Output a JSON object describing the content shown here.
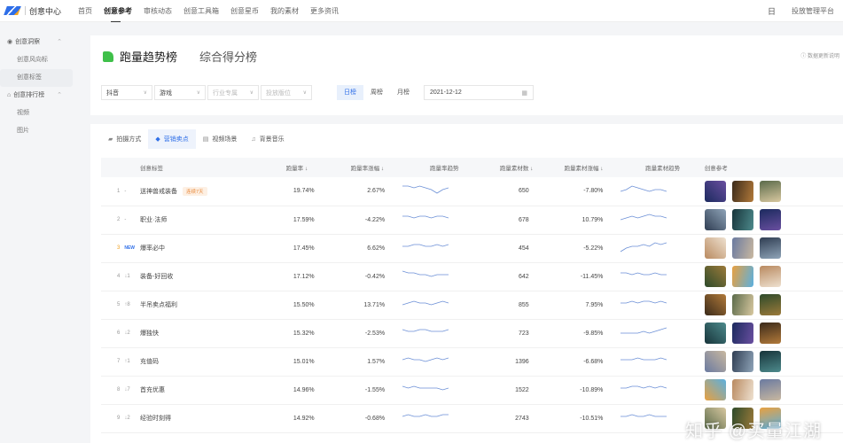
{
  "app": {
    "name": "创意中心"
  },
  "nav": [
    "首页",
    "创意参考",
    "审核动态",
    "创意工具箱",
    "创意星币",
    "我的素材",
    "更多资讯"
  ],
  "nav_active": 1,
  "topright": {
    "calendar_icon": "日",
    "platform": "投放管理平台"
  },
  "sidebar": [
    {
      "label": "创意洞察",
      "type": "group",
      "icon": "eye-icon"
    },
    {
      "label": "创意风向标",
      "type": "sub"
    },
    {
      "label": "创意标签",
      "type": "sub",
      "active": true
    },
    {
      "label": "创意排行榜",
      "type": "group",
      "icon": "chart-icon"
    },
    {
      "label": "视频",
      "type": "sub"
    },
    {
      "label": "图片",
      "type": "sub"
    }
  ],
  "header": {
    "title_active": "跑量趋势榜",
    "title_other": "综合得分榜",
    "note": "数据更新说明"
  },
  "filters": {
    "platform": "抖音",
    "category": "游戏",
    "industry_placeholder": "行业专属",
    "position_placeholder": "投放版位",
    "periods": [
      "日榜",
      "周榜",
      "月榜"
    ],
    "active_period": 0,
    "date": "2021-12-12"
  },
  "tabs": [
    {
      "label": "拍摄方式",
      "icon": "camera-icon"
    },
    {
      "label": "营销卖点",
      "icon": "tag-icon"
    },
    {
      "label": "视频场景",
      "icon": "scene-icon"
    },
    {
      "label": "背景音乐",
      "icon": "music-icon"
    }
  ],
  "active_tab": 1,
  "columns": [
    "创意标签",
    "跑量率 ↓",
    "跑量率涨幅 ↓",
    "跑量率趋势",
    "跑量素材数 ↓",
    "跑量素材涨幅 ↓",
    "跑量素材趋势",
    "创意参考"
  ],
  "rows": [
    {
      "rank": "1",
      "change": "-",
      "label": "送神兽戒装备",
      "badge": "连续7天",
      "rate": "19.74%",
      "rate_growth": "2.67%",
      "materials": "650",
      "mat_growth": "-7.80%",
      "t1": [
        5,
        5,
        4,
        5,
        4,
        3,
        1,
        3,
        4
      ],
      "t2": [
        2,
        3,
        5,
        4,
        3,
        2,
        3,
        3,
        2
      ]
    },
    {
      "rank": "2",
      "change": "-",
      "label": "职业·法师",
      "rate": "17.59%",
      "rate_growth": "-4.22%",
      "materials": "678",
      "mat_growth": "10.79%",
      "t1": [
        4,
        4,
        3,
        4,
        4,
        3,
        4,
        4,
        3
      ],
      "t2": [
        2,
        3,
        4,
        3,
        4,
        5,
        4,
        4,
        3
      ]
    },
    {
      "rank": "3",
      "change": "NEW",
      "label": "爆率必中",
      "rate": "17.45%",
      "rate_growth": "6.62%",
      "materials": "454",
      "mat_growth": "-5.22%",
      "t1": [
        3,
        3,
        4,
        4,
        3,
        3,
        4,
        3,
        4
      ],
      "t2": [
        0,
        2,
        3,
        3,
        4,
        3,
        5,
        4,
        5
      ]
    },
    {
      "rank": "4",
      "change": "↓1",
      "label": "装备-好回收",
      "rate": "17.12%",
      "rate_growth": "-0.42%",
      "materials": "642",
      "mat_growth": "-11.45%",
      "t1": [
        5,
        4,
        4,
        3,
        3,
        2,
        3,
        3,
        3
      ],
      "t2": [
        4,
        4,
        3,
        4,
        3,
        3,
        4,
        3,
        3
      ]
    },
    {
      "rank": "5",
      "change": "↑8",
      "label": "半吊卖点福利",
      "rate": "15.50%",
      "rate_growth": "13.71%",
      "materials": "855",
      "mat_growth": "7.95%",
      "t1": [
        2,
        3,
        4,
        3,
        3,
        2,
        3,
        4,
        3
      ],
      "t2": [
        3,
        3,
        4,
        3,
        4,
        4,
        3,
        4,
        3
      ]
    },
    {
      "rank": "6",
      "change": "↓2",
      "label": "爆独快",
      "rate": "15.32%",
      "rate_growth": "-2.53%",
      "materials": "723",
      "mat_growth": "-9.85%",
      "t1": [
        4,
        3,
        3,
        4,
        4,
        3,
        3,
        3,
        4
      ],
      "t2": [
        2,
        2,
        2,
        2,
        3,
        2,
        3,
        4,
        5
      ]
    },
    {
      "rank": "7",
      "change": "↑1",
      "label": "充值码",
      "rate": "15.01%",
      "rate_growth": "1.57%",
      "materials": "1396",
      "mat_growth": "-6.68%",
      "t1": [
        3,
        4,
        3,
        3,
        2,
        3,
        4,
        3,
        4
      ],
      "t2": [
        3,
        3,
        3,
        4,
        3,
        3,
        3,
        4,
        3
      ]
    },
    {
      "rank": "8",
      "change": "↓7",
      "label": "首充优惠",
      "rate": "14.96%",
      "rate_growth": "-1.55%",
      "materials": "1522",
      "mat_growth": "-10.89%",
      "t1": [
        4,
        3,
        4,
        3,
        3,
        3,
        3,
        2,
        3
      ],
      "t2": [
        3,
        3,
        4,
        4,
        3,
        4,
        3,
        4,
        3
      ]
    },
    {
      "rank": "9",
      "change": "↓2",
      "label": "经验时刻得",
      "rate": "14.92%",
      "rate_growth": "-0.68%",
      "materials": "2743",
      "mat_growth": "-10.51%",
      "t1": [
        3,
        4,
        3,
        3,
        4,
        3,
        3,
        4,
        4
      ],
      "t2": [
        3,
        3,
        4,
        3,
        3,
        4,
        3,
        3,
        3
      ]
    }
  ],
  "watermark": "知乎 @买量江湖",
  "colors": {
    "accent": "#2f6fe8",
    "spark": "#6b8fd6",
    "badge": "#e98a3b"
  }
}
